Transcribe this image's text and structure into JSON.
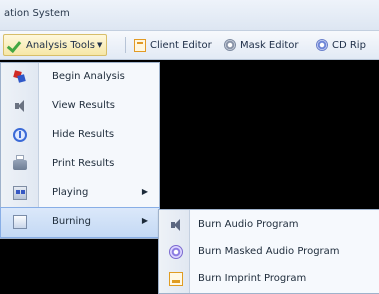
{
  "window": {
    "title": "ation System"
  },
  "toolbar": {
    "analysis_tools": "Analysis Tools",
    "client_editor": "Client Editor",
    "mask_editor": "Mask Editor",
    "cd_rip": "CD Rip"
  },
  "menu": {
    "items": [
      {
        "label": "Begin Analysis",
        "icon": "begin-analysis-icon"
      },
      {
        "label": "View Results",
        "icon": "speaker-icon"
      },
      {
        "label": "Hide Results",
        "icon": "hide-icon"
      },
      {
        "label": "Print Results",
        "icon": "printer-icon"
      },
      {
        "label": "Playing",
        "icon": "playing-icon",
        "submenu_arrow": "▶"
      },
      {
        "label": "Burning",
        "icon": "burning-icon",
        "submenu_arrow": "▶"
      }
    ]
  },
  "submenu": {
    "items": [
      {
        "label": "Burn Audio Program",
        "icon": "audio-icon"
      },
      {
        "label": "Burn Masked Audio Program",
        "icon": "masked-disc-icon"
      },
      {
        "label": "Burn Imprint Program",
        "icon": "imprint-icon"
      }
    ]
  },
  "colors": {
    "highlight": "#c4d9f4",
    "menu_background": "#f5f8fc",
    "app_background": "#000000"
  }
}
